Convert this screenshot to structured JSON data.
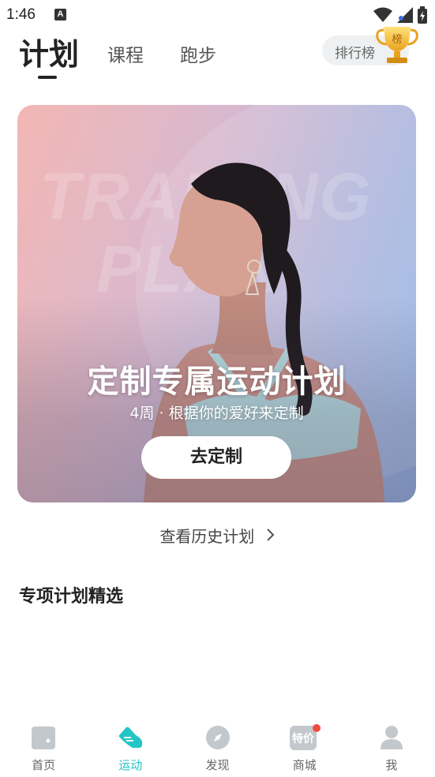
{
  "status_bar": {
    "time": "1:46",
    "notification_badge": "A"
  },
  "top_tabs": {
    "active": "计划",
    "tabs": [
      "课程",
      "跑步"
    ]
  },
  "leaderboard": {
    "label": "排行榜",
    "trophy_text": "榜"
  },
  "banner": {
    "bg_word_1": "TRAINING",
    "bg_word_2": "PLAN",
    "title": "定制专属运动计划",
    "subtitle": "4周 · 根据你的爱好来定制",
    "button_label": "去定制"
  },
  "history_link": "查看历史计划",
  "section_title": "专项计划精选",
  "bottom_nav": [
    {
      "label": "首页",
      "icon": "home-icon",
      "active": false
    },
    {
      "label": "运动",
      "icon": "sport-shoe-icon",
      "active": true
    },
    {
      "label": "发现",
      "icon": "compass-icon",
      "active": false
    },
    {
      "label": "商城",
      "icon": "shop-sale-icon",
      "active": false,
      "badge_text": "特价"
    },
    {
      "label": "我",
      "icon": "profile-icon",
      "active": false
    }
  ],
  "colors": {
    "accent": "#24c5c5",
    "badge_red": "#f04a3c"
  }
}
